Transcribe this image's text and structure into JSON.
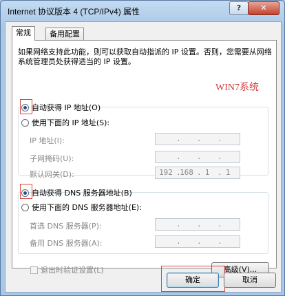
{
  "window": {
    "title": "Internet 协议版本 4 (TCP/IPv4) 属性",
    "help_glyph": "?",
    "close_glyph": "✕"
  },
  "tabs": [
    {
      "label": "常规",
      "active": true
    },
    {
      "label": "备用配置",
      "active": false
    }
  ],
  "description": "如果网络支持此功能，则可以获取自动指派的 IP 设置。否则，您需要从网络系统管理员处获得适当的 IP 设置。",
  "watermark": "WIN7系统",
  "ip_section": {
    "auto_label": "自动获得 IP 地址(O)",
    "manual_label": "使用下面的 IP 地址(S):",
    "fields": [
      {
        "label": "IP 地址(I):",
        "value": [
          "",
          "",
          "",
          ""
        ]
      },
      {
        "label": "子网掩码(U):",
        "value": [
          "",
          "",
          "",
          ""
        ]
      },
      {
        "label": "默认网关(D):",
        "value": [
          "192",
          "168",
          "1",
          "1"
        ]
      }
    ]
  },
  "dns_section": {
    "auto_label": "自动获得 DNS 服务器地址(B)",
    "manual_label": "使用下面的 DNS 服务器地址(E):",
    "fields": [
      {
        "label": "首选 DNS 服务器(P):",
        "value": [
          "",
          "",
          "",
          ""
        ]
      },
      {
        "label": "备用 DNS 服务器(A):",
        "value": [
          "",
          "",
          "",
          ""
        ]
      }
    ]
  },
  "validate_label": "退出时验证设置(L)",
  "advanced_label": "高级(V)...",
  "ok_label": "确定",
  "cancel_label": "取消",
  "colors": {
    "highlight": "#d8453c",
    "watermark": "#d23c3c"
  }
}
